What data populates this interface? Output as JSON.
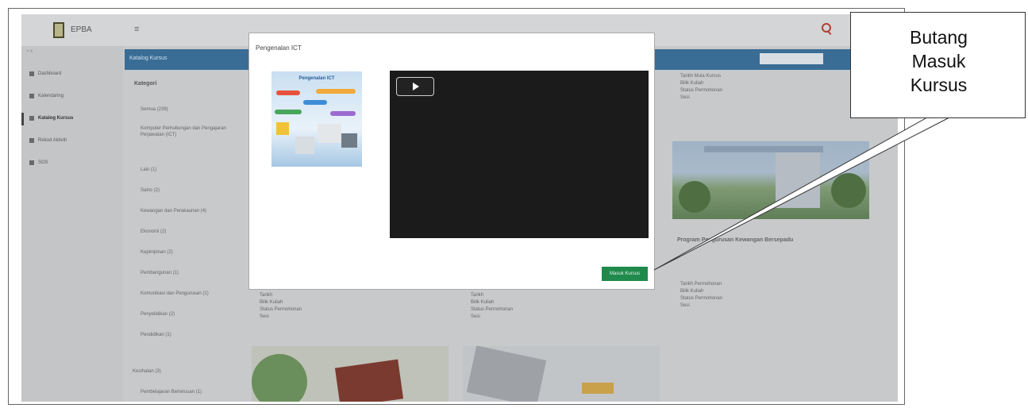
{
  "app": {
    "brand": "EPBA",
    "side_top": "= x",
    "nav": [
      {
        "label": "Dashboard"
      },
      {
        "label": "Kalendaring"
      },
      {
        "label": "Katalog Kursus"
      },
      {
        "label": "Rekod Aktiviti"
      },
      {
        "label": "SOS"
      }
    ],
    "page_header": "Katalog Kursus",
    "categories_title": "Kategori",
    "categories": [
      "Semua (239)",
      "Komputer Perhubungan dan Pengajaran Perjawatan (ICT)",
      "Lain (1)",
      "Sains (2)",
      "Kewangan dan Perakaunan (4)",
      "Ekonomi (2)",
      "Kepimpinan (2)",
      "Pembangunan (1)",
      "Komunikasi dan Pengurusan (1)",
      "Penyelidikan (2)",
      "Pendidikan (1)",
      "Kesihatan (3)",
      "Pembelajaran Berterusan (1)"
    ],
    "card_right_lines": [
      "Tarikh Mula Kursus",
      "Bilik Kuliah",
      "Status Permohonan",
      "Sesi"
    ],
    "card_right_bottom_lines": [
      "Tarikh Permohonan",
      "Bilik Kuliah",
      "Status Permohonan",
      "Sesi"
    ],
    "card_right_title": "Program Pengurusan Kewangan Bersepadu",
    "card_mid_lines": [
      "Tarikh",
      "Bilik Kuliah",
      "Status Permohonan",
      "Sesi"
    ]
  },
  "modal": {
    "title": "Pengenalan ICT",
    "thumbnail_title": "Pengenalan ICT",
    "enter_button": "Masuk Kursus"
  },
  "callout": {
    "text": "Butang\nMasuk\nKursus"
  },
  "colors": {
    "header_blue": "#3a6d95",
    "enter_green": "#1f8a4c",
    "video_bg": "#1b1b1c"
  }
}
